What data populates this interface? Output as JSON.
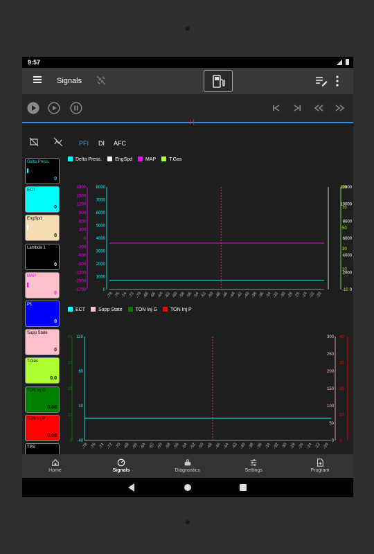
{
  "status": {
    "time": "9:57"
  },
  "appbar": {
    "title": "Signals"
  },
  "tabs": [
    {
      "label": "PFI",
      "active": true
    },
    {
      "label": "DI",
      "active": false
    },
    {
      "label": "AFC",
      "active": false
    }
  ],
  "tiles": [
    {
      "label": "Delta Press.",
      "value": "0",
      "bg": "#000000",
      "fg": "#00e5ff",
      "bar": "#00ffff"
    },
    {
      "label": "ECT",
      "value": "0",
      "bg": "#00ffff",
      "fg": "#000000",
      "bar": ""
    },
    {
      "label": "EngSpd",
      "value": "0",
      "bg": "#f5deb3",
      "fg": "#000000",
      "bar": "#ffffff"
    },
    {
      "label": "Lambda 1",
      "value": "0",
      "bg": "#000000",
      "fg": "#ffffff",
      "bar": ""
    },
    {
      "label": "MAP",
      "value": "0",
      "bg": "#ffc0cb",
      "fg": "#ff00ff",
      "bar": "#ff00ff"
    },
    {
      "label": "P1",
      "value": "0",
      "bg": "#0000ff",
      "fg": "#ffffff",
      "bar": ""
    },
    {
      "label": "Supp State",
      "value": "0",
      "bg": "#ffc0cb",
      "fg": "#000000",
      "bar": ""
    },
    {
      "label": "T.Gas",
      "value": "0.0",
      "bg": "#adff2f",
      "fg": "#000000",
      "bar": ""
    },
    {
      "label": "TON Inj G",
      "value": "0.00",
      "bg": "#008000",
      "fg": "#000000",
      "bar": ""
    },
    {
      "label": "TON Inj P",
      "value": "0.00",
      "bg": "#ff0000",
      "fg": "#000000",
      "bar": ""
    },
    {
      "label": "TPS",
      "value": "",
      "bg": "#000000",
      "fg": "#ffffff",
      "bar": ""
    }
  ],
  "legend1": [
    {
      "name": "Delta Press.",
      "color": "#00ffff"
    },
    {
      "name": "EngSpd",
      "color": "#ffffff"
    },
    {
      "name": "MAP",
      "color": "#ff00ff"
    },
    {
      "name": "T.Gas",
      "color": "#adff2f"
    }
  ],
  "legend2": [
    {
      "name": "ECT",
      "color": "#00ffff"
    },
    {
      "name": "Supp State",
      "color": "#ffc0cb"
    },
    {
      "name": "TON Inj G",
      "color": "#008000"
    },
    {
      "name": "TON Inj P",
      "color": "#ff0000"
    }
  ],
  "chart_data": [
    {
      "type": "line",
      "title": "",
      "x_ticks": [
        "-78",
        "-76",
        "-74",
        "-72",
        "-70",
        "-68",
        "-66",
        "-64",
        "-62",
        "-60",
        "-58",
        "-56",
        "-54",
        "-52",
        "-50",
        "-48",
        "-46",
        "-44",
        "-42",
        "-40",
        "-38",
        "-36",
        "-34",
        "-32",
        "-30",
        "-28",
        "-26",
        "-24",
        "-22",
        "-20"
      ],
      "axes": [
        {
          "label": "",
          "color": "#ff00ff",
          "ticks": [
            "1800",
            "1500",
            "1200",
            "900",
            "600",
            "300",
            "0",
            "-300",
            "-600",
            "-900",
            "-1200",
            "-1500",
            "-1700"
          ]
        },
        {
          "label": "",
          "color": "#00ffff",
          "ticks": [
            "8000",
            "7000",
            "6000",
            "5000",
            "4000",
            "3000",
            "2000",
            "1000",
            "0"
          ]
        },
        {
          "label": "",
          "color": "#ffffff",
          "ticks": [
            "12000",
            "10000",
            "8000",
            "6000",
            "4000",
            "2000",
            "0"
          ]
        },
        {
          "label": "",
          "color": "#adff2f",
          "ticks": [
            "90",
            "70",
            "50",
            "30",
            "10",
            "-10"
          ]
        }
      ],
      "series": [
        {
          "name": "MAP",
          "values": [
            0
          ]
        },
        {
          "name": "Delta Press.",
          "values": [
            0
          ]
        }
      ]
    },
    {
      "type": "line",
      "title": "",
      "x_ticks": [
        "-78",
        "-76",
        "-74",
        "-72",
        "-70",
        "-68",
        "-66",
        "-64",
        "-62",
        "-60",
        "-58",
        "-56",
        "-54",
        "-52",
        "-50",
        "-48",
        "-46",
        "-44",
        "-42",
        "-40",
        "-38",
        "-36",
        "-34",
        "-32",
        "-30",
        "-28",
        "-26",
        "-24",
        "-22",
        "-20"
      ],
      "axes": [
        {
          "label": "",
          "color": "#008000",
          "ticks": [
            "40",
            "30",
            "20",
            "10",
            "0"
          ]
        },
        {
          "label": "",
          "color": "#00ffff",
          "ticks": [
            "110",
            "60",
            "10",
            "-40"
          ]
        },
        {
          "label": "",
          "color": "#ffc0cb",
          "ticks": [
            "300",
            "250",
            "200",
            "150",
            "100",
            "50",
            "0"
          ]
        },
        {
          "label": "",
          "color": "#ff0000",
          "ticks": [
            "40",
            "30",
            "20",
            "10",
            "0"
          ]
        }
      ],
      "series": [
        {
          "name": "ECT",
          "values": [
            0
          ]
        }
      ]
    }
  ],
  "nav": [
    {
      "label": "Home",
      "icon": "home-icon",
      "active": false
    },
    {
      "label": "Signals",
      "icon": "gauge-icon",
      "active": true
    },
    {
      "label": "Diagnostics",
      "icon": "diagnostics-icon",
      "active": false
    },
    {
      "label": "Settings",
      "icon": "sliders-icon",
      "active": false
    },
    {
      "label": "Program",
      "icon": "program-icon",
      "active": false
    }
  ]
}
